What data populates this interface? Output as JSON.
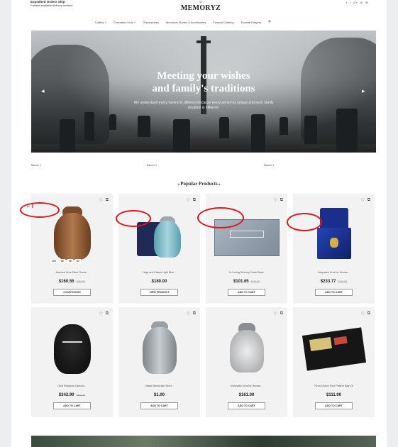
{
  "header": {
    "ship_title": "Expedited Orders Ship",
    "ship_sub": "Fastest available delivery method",
    "logo": "MEMORYZ",
    "socials": [
      "f",
      "t",
      "G+",
      "◎",
      "⊕"
    ]
  },
  "nav": {
    "items": [
      "Coffins",
      "Cremation Urns",
      "Gravestones",
      "Memorial Stones & Accessories",
      "Funeral Clothing",
      "Funeral Prayers"
    ]
  },
  "hero": {
    "title_line1": "Meeting your wishes",
    "title_line2": "and family's traditions",
    "subtitle": "We understand every funeral is different because every person is unique and each family situation is different."
  },
  "banners": [
    "Banner 1",
    "Banner 2",
    "Banner 3"
  ],
  "section_title": "Popular Products",
  "products": [
    {
      "name": "Arazune Urns Silver Roses...",
      "price": "$160.55",
      "old": "$188.88",
      "button": "COUNTDOWN",
      "timer": [
        "209",
        "06",
        "38",
        "40"
      ]
    },
    {
      "name": "Hugs and Kisses Light Blue...",
      "price": "$180.00",
      "old": "",
      "button": "VIEW PRODUCT"
    },
    {
      "name": "In Loving Memory Guest Book",
      "price": "$101.65",
      "old": "$119.59",
      "button": "ADD TO CART"
    },
    {
      "name": "Keepsake Urns for Human...",
      "price": "$233.77",
      "old": "$275.03",
      "button": "ADD TO CART"
    },
    {
      "name": "Gold Religious Catholic...",
      "price": "$342.90",
      "old": "$403.41",
      "button": "ADD TO CART"
    },
    {
      "name": "Liliane Memorials Silver...",
      "price": "$1.00",
      "old": "",
      "button": "ADD TO CART"
    },
    {
      "name": "Keepsake Urns for Human...",
      "price": "$161.00",
      "old": "",
      "button": "ADD TO CART"
    },
    {
      "name": "Pinot Choice Pure Pattern Bag Kit",
      "price": "$111.00",
      "old": "",
      "button": "ADD TO CART"
    }
  ],
  "colors": {
    "accent": "#e0141c",
    "card_bg": "#f2f2f2",
    "hero_dark": "#1c1f21"
  }
}
